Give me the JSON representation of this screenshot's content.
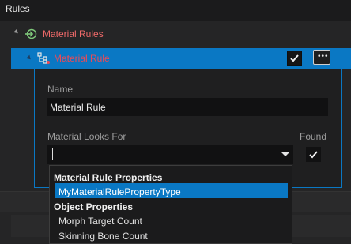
{
  "panel_title": "Rules",
  "tree": {
    "material_rules_label": "Material Rules",
    "material_rule_label": "Material Rule"
  },
  "properties": {
    "name_label": "Name",
    "name_value": "Material Rule",
    "looks_for_label": "Material Looks For",
    "found_label": "Found",
    "looks_for_value": ""
  },
  "dropdown": {
    "group1_header": "Material Rule Properties",
    "group1_items": [
      "MyMaterialRulePropertyType"
    ],
    "group2_header": "Object Properties",
    "group2_items": [
      "Morph Target Count",
      "Skinning Bone Count"
    ]
  },
  "colors": {
    "accent": "#0a78c4",
    "rule_text": "#ee4a55",
    "rules_group_text": "#f06a6a",
    "rules_icon": "#7ec77a"
  },
  "icons": {
    "rules_group": "import-arrow-icon",
    "rule": "rule-node-icon",
    "more": "ellipsis-icon",
    "check": "checkmark-icon",
    "combo": "chevron-down-icon",
    "expand": "tree-expand-arrow-icon"
  }
}
